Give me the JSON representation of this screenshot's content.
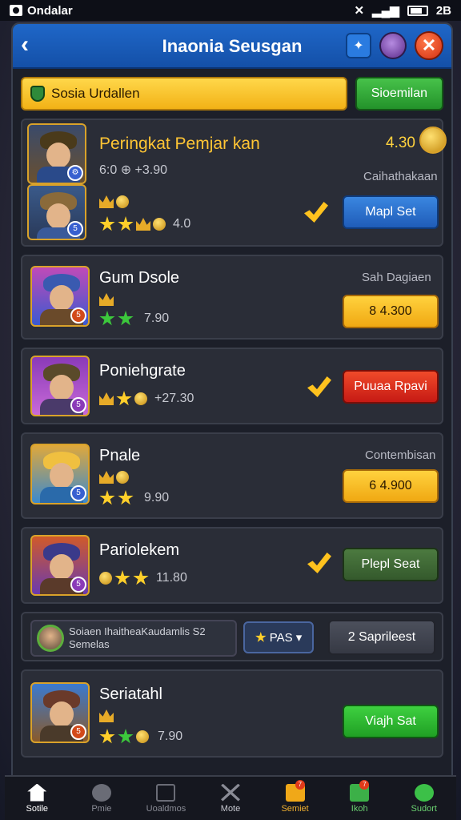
{
  "status": {
    "app_name": "Ondalar",
    "time": "2B"
  },
  "header": {
    "title": "Inaonia Seusgan"
  },
  "filter": {
    "search_label": "Sosia Urdallen",
    "action_label": "Sioemilan"
  },
  "cards": [
    {
      "name": "Peringkat Pemjar kan",
      "sub": "6:0 ⊕ +3.90",
      "value": "4.30",
      "note": "Caihathakaan",
      "stat": "4.0",
      "button": "Mapl Set"
    },
    {
      "name": "Gum Dsole",
      "note": "Sah Dagiaen",
      "stat": "7.90",
      "button": "8 4.300"
    },
    {
      "name": "Poniehgrate",
      "stat": "+27.30",
      "button": "Puuaa Rpavi"
    },
    {
      "name": "Pnale",
      "note": "Contembisan",
      "stat": "9.90",
      "button": "6 4.900"
    },
    {
      "name": "Pariolekem",
      "stat": "11.80",
      "button": "Plepl Seat"
    }
  ],
  "promo": {
    "line1": "Soiaen IhaitheaKaudamlis S2",
    "line2": "Semelas",
    "select_label": "PAS",
    "button": "2 Saprileest"
  },
  "card_last": {
    "name": "Seriatahl",
    "stat": "7.90",
    "button": "Viajh Sat"
  },
  "nav": [
    {
      "label": "Sotile",
      "icon": "home-icon"
    },
    {
      "label": "Pmie",
      "icon": "gear-wheel-icon"
    },
    {
      "label": "Uoaldmos",
      "icon": "book-icon"
    },
    {
      "label": "Mote",
      "icon": "swords-icon"
    },
    {
      "label": "Semiet",
      "icon": "chest-icon",
      "badge": "7"
    },
    {
      "label": "Ikoh",
      "icon": "map-icon",
      "badge": "7"
    },
    {
      "label": "Sudort",
      "icon": "globe-icon"
    }
  ]
}
